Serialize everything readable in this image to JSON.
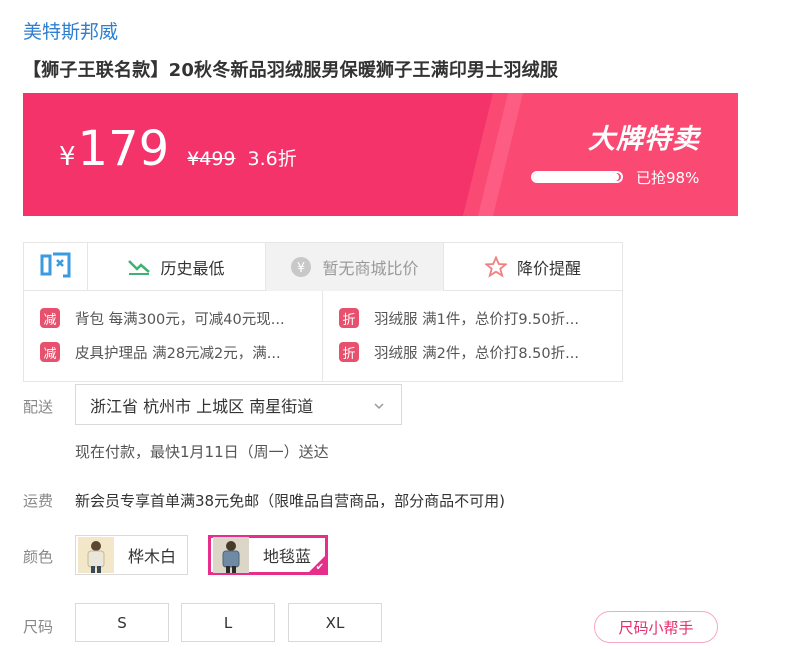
{
  "brand": "美特斯邦威",
  "product_title": "【狮子王联名款】20秋冬新品羽绒服男保暖狮子王满印男士羽绒服",
  "banner": {
    "currency": "¥",
    "price": "179",
    "original_price": "¥499",
    "discount": "3.6折",
    "promo_title": "大牌特卖",
    "sold_progress": 0.98,
    "sold_text": "已抢98%",
    "color": "#f5336b"
  },
  "tools": {
    "buy_icon": "gou-icon",
    "history_low": "历史最低",
    "compare": "暂无商城比价",
    "price_alert": "降价提醒"
  },
  "coupons": {
    "left": [
      {
        "tag": "减",
        "text": "背包 每满300元，可减40元现..."
      },
      {
        "tag": "减",
        "text": "皮具护理品 满28元减2元，满..."
      }
    ],
    "right": [
      {
        "tag": "折",
        "text": "羽绒服 满1件，总价打9.50折..."
      },
      {
        "tag": "折",
        "text": "羽绒服 满2件，总价打8.50折..."
      }
    ]
  },
  "delivery": {
    "label": "配送",
    "address": "浙江省 杭州市 上城区 南星街道",
    "note": "现在付款，最快1月11日（周一）送达"
  },
  "shipping": {
    "label": "运费",
    "text": "新会员专享首单满38元免邮（限唯品自营商品，部分商品不可用)"
  },
  "color": {
    "label": "颜色",
    "options": [
      {
        "name": "桦木白",
        "selected": false
      },
      {
        "name": "地毯蓝",
        "selected": true
      }
    ],
    "accent": "#e62e8a"
  },
  "size": {
    "label": "尺码",
    "options": [
      "S",
      "L",
      "XL"
    ],
    "helper": "尺码小帮手"
  }
}
